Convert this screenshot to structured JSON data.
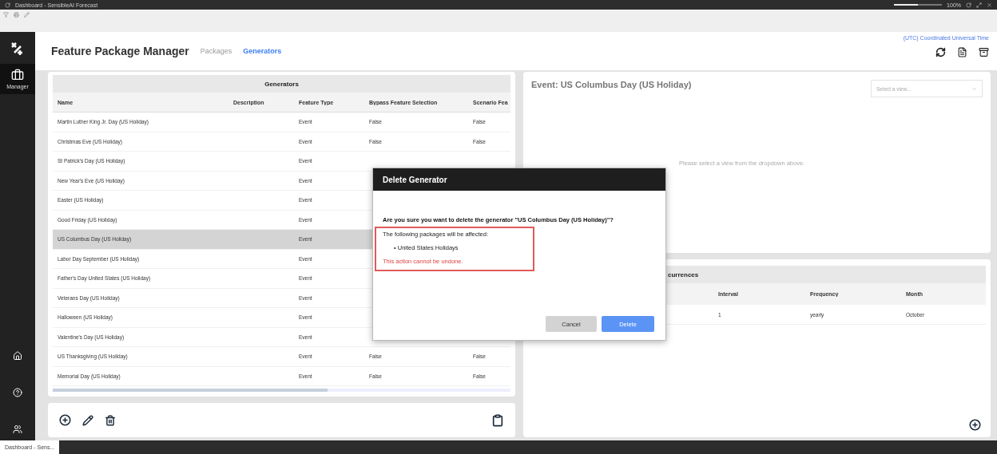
{
  "window": {
    "title": "Dashboard - SensibleAI Forecast",
    "zoom": "100%",
    "zoom_slider": {
      "level": 0.5
    }
  },
  "sidebar": {
    "manager_label": "Manager"
  },
  "header": {
    "title": "Feature Package Manager",
    "timezone": "(UTC) Coordinated Universal Time",
    "tabs": [
      {
        "label": "Packages",
        "selected": false
      },
      {
        "label": "Generators",
        "selected": true
      }
    ]
  },
  "generators_table": {
    "title": "Generators",
    "columns": [
      "Name",
      "Description",
      "Feature Type",
      "Bypass Feature Selection",
      "Scenario Fea"
    ],
    "rows": [
      {
        "name": "Martin Luther King Jr. Day (US Holiday)",
        "feature_type": "Event",
        "bypass": "False",
        "scenario": "False",
        "selected": false
      },
      {
        "name": "Christmas Eve (US Holiday)",
        "feature_type": "Event",
        "bypass": "False",
        "scenario": "False",
        "selected": false
      },
      {
        "name": "St Patrick's Day (US Holiday)",
        "feature_type": "Event",
        "selected": false
      },
      {
        "name": "New Year's Eve (US Holiday)",
        "feature_type": "Event",
        "selected": false
      },
      {
        "name": "Easter (US Holiday)",
        "feature_type": "Event",
        "selected": false
      },
      {
        "name": "Good Friday (US Holiday)",
        "feature_type": "Event",
        "selected": false
      },
      {
        "name": "US Columbus Day (US Holiday)",
        "feature_type": "Event",
        "selected": true
      },
      {
        "name": "Labor Day September (US Holiday)",
        "feature_type": "Event",
        "selected": false
      },
      {
        "name": "Father's Day United States (US Holiday)",
        "feature_type": "Event",
        "selected": false
      },
      {
        "name": "Veterans Day (US Holiday)",
        "feature_type": "Event",
        "selected": false
      },
      {
        "name": "Halloween (US Holiday)",
        "feature_type": "Event",
        "selected": false
      },
      {
        "name": "Valentine's Day (US Holiday)",
        "feature_type": "Event",
        "selected": false
      },
      {
        "name": "US Thanksgiving (US Holiday)",
        "feature_type": "Event",
        "bypass": "False",
        "scenario": "False",
        "selected": false
      },
      {
        "name": "Memorial Day (US Holiday)",
        "feature_type": "Event",
        "bypass": "False",
        "scenario": "False",
        "selected": false
      }
    ]
  },
  "event_panel": {
    "title": "Event: US Columbus Day (US Holiday)",
    "view_select": {
      "placeholder": "Select a view..."
    },
    "empty_message": "Please select a view from the dropdown above."
  },
  "occurrences": {
    "title": "currences",
    "columns": [
      "Interval",
      "Frequency",
      "Month"
    ],
    "rows": [
      [
        "1",
        "yearly",
        "October"
      ]
    ]
  },
  "dialog": {
    "title": "Delete Generator",
    "question": "Are you sure you want to delete the generator \"US Columbus Day (US Holiday)\"?",
    "affected_label": "The following packages will be affected:",
    "bullet": "•",
    "packages": [
      "United States Holidays"
    ],
    "warning": "This action cannot be undone.",
    "buttons": [
      {
        "label": "Cancel",
        "kind": "secondary"
      },
      {
        "label": "Delete",
        "kind": "primary"
      }
    ]
  },
  "taskbar": {
    "tab": "Dashboard - Sens..."
  }
}
